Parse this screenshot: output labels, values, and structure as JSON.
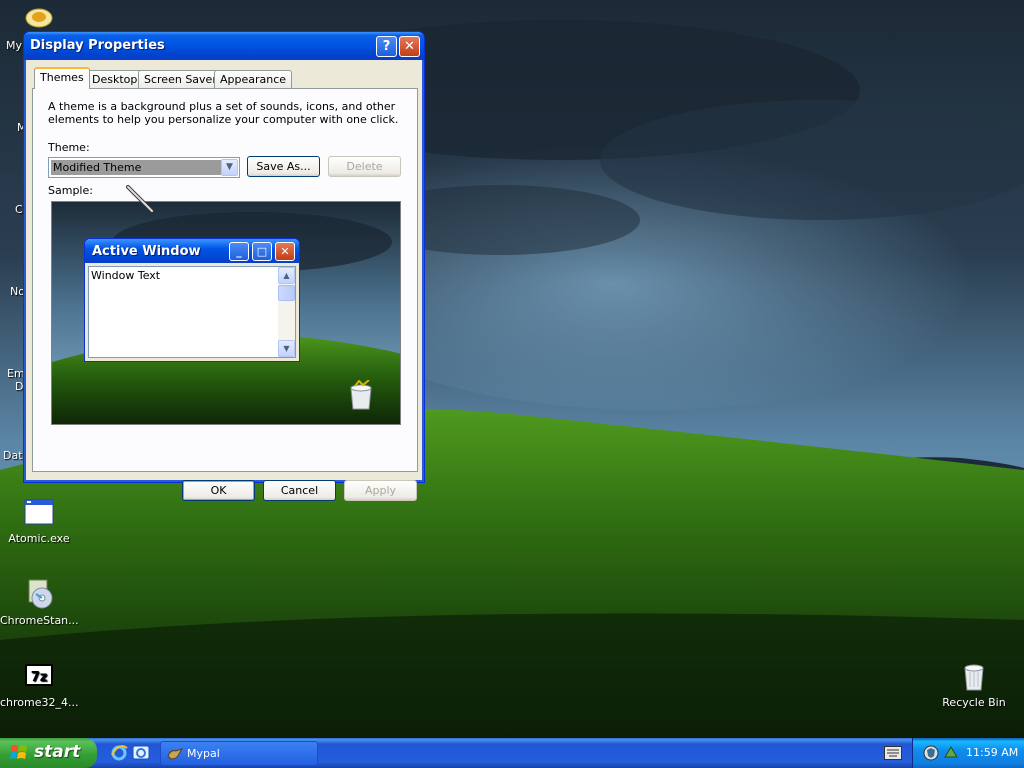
{
  "desktop": {
    "icons": [
      {
        "label": "Atomic.exe",
        "icon": "window-exe-icon"
      },
      {
        "label": "ChromeStan...",
        "icon": "installer-cd-icon"
      },
      {
        "label": "chrome32_4...",
        "icon": "7zip-archive-icon"
      },
      {
        "label": "Recycle Bin",
        "icon": "recycle-bin-icon"
      }
    ],
    "edge_labels": [
      "My",
      "M",
      "C",
      "No",
      "Em",
      "D",
      "Dat"
    ]
  },
  "dialog": {
    "title": "Display Properties",
    "help_glyph": "?",
    "close_glyph": "✕",
    "tabs": [
      {
        "label": "Themes",
        "active": true
      },
      {
        "label": "Desktop",
        "active": false
      },
      {
        "label": "Screen Saver",
        "active": false
      },
      {
        "label": "Appearance",
        "active": false
      }
    ],
    "description": "A theme is a background plus a set of sounds, icons, and other elements to help you personalize your computer with one click.",
    "theme_label": "Theme:",
    "theme_value": "Modified Theme",
    "save_as_label": "Save As...",
    "delete_label": "Delete",
    "sample_label": "Sample:",
    "sample_window": {
      "title": "Active Window",
      "text": "Window Text"
    },
    "ok_label": "OK",
    "cancel_label": "Cancel",
    "apply_label": "Apply"
  },
  "taskbar": {
    "start_label": "start",
    "tasks": [
      {
        "label": "Mypal",
        "icon": "mypal-icon"
      }
    ],
    "clock": "11:59 AM"
  },
  "colors": {
    "title_blue": "#0055e5",
    "start_green": "#35a035",
    "dialog_face": "#ece9d8"
  }
}
